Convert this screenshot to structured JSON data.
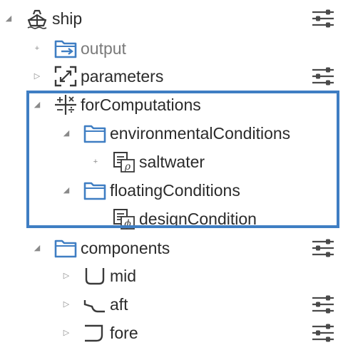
{
  "tree": {
    "ship": {
      "label": "ship",
      "icon": "ship-icon",
      "toggle": "◢"
    },
    "output": {
      "label": "output",
      "icon": "output-folder-icon",
      "toggle": "+"
    },
    "parameters": {
      "label": "parameters",
      "icon": "parameters-icon",
      "toggle": "▷"
    },
    "forComputations": {
      "label": "forComputations",
      "icon": "computations-icon",
      "toggle": "◢"
    },
    "environmentalConditions": {
      "label": "environmentalConditions",
      "icon": "folder-icon",
      "toggle": "◢"
    },
    "saltwater": {
      "label": "saltwater",
      "icon": "rho-document-icon",
      "toggle": "+"
    },
    "floatingConditions": {
      "label": "floatingConditions",
      "icon": "folder-icon",
      "toggle": "◢"
    },
    "designCondition": {
      "label": "designCondition",
      "icon": "phi-document-icon"
    },
    "components": {
      "label": "components",
      "icon": "folder-icon",
      "toggle": "◢"
    },
    "mid": {
      "label": "mid",
      "icon": "mid-section-icon",
      "toggle": "▷"
    },
    "aft": {
      "label": "aft",
      "icon": "aft-section-icon",
      "toggle": "▷"
    },
    "fore": {
      "label": "fore",
      "icon": "fore-section-icon",
      "toggle": "▷"
    }
  },
  "colors": {
    "accent": "#3f7ec3",
    "text": "#2b2b2b",
    "muted_text": "#7a7a7a",
    "icon_dark": "#3a3a3a"
  }
}
